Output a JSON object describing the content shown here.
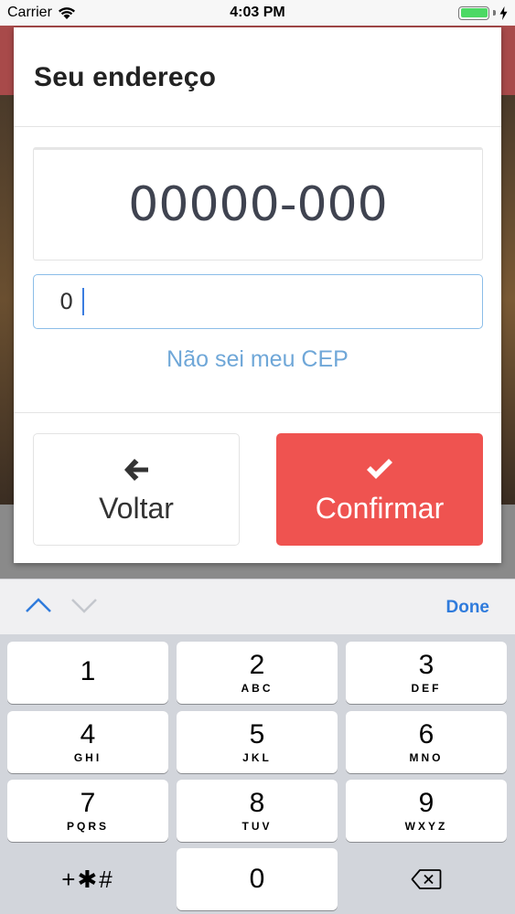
{
  "status_bar": {
    "carrier": "Carrier",
    "time": "4:03 PM"
  },
  "modal": {
    "title": "Seu endereço",
    "cep_display": "00000-000",
    "cep_input_value": "0",
    "cep_link": "Não sei meu CEP",
    "back_label": "Voltar",
    "confirm_label": "Confirmar"
  },
  "accessory": {
    "done_label": "Done"
  },
  "keyboard": {
    "keys": [
      {
        "num": "1",
        "letters": ""
      },
      {
        "num": "2",
        "letters": "ABC"
      },
      {
        "num": "3",
        "letters": "DEF"
      },
      {
        "num": "4",
        "letters": "GHI"
      },
      {
        "num": "5",
        "letters": "JKL"
      },
      {
        "num": "6",
        "letters": "MNO"
      },
      {
        "num": "7",
        "letters": "PQRS"
      },
      {
        "num": "8",
        "letters": "TUV"
      },
      {
        "num": "9",
        "letters": "WXYZ"
      }
    ],
    "symbols_label": "+✱#",
    "zero": "0"
  },
  "colors": {
    "accent_red": "#ef5350",
    "link_blue": "#6fa7d8",
    "done_blue": "#2f7bdc"
  }
}
